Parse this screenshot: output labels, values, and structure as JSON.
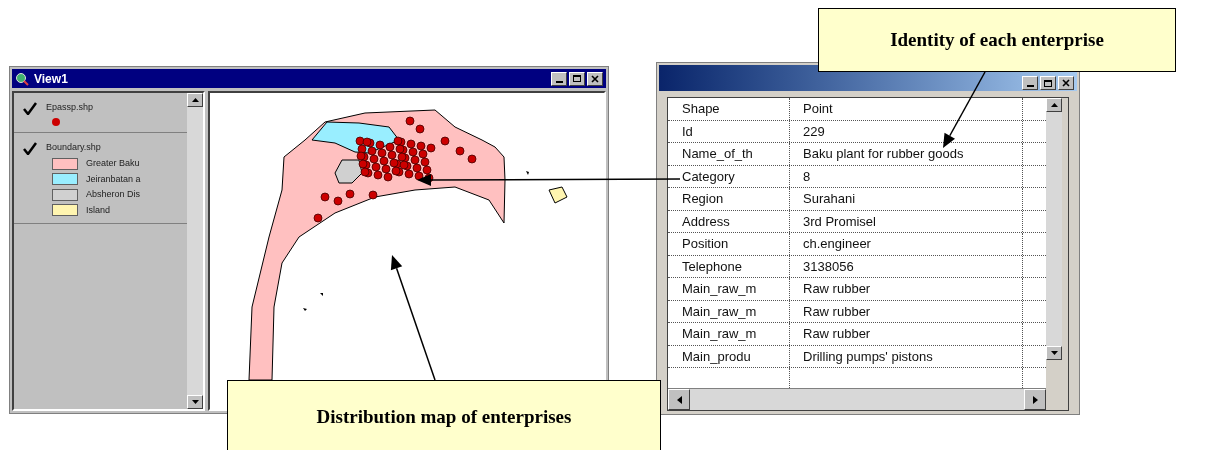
{
  "view_window": {
    "title": "View1",
    "legend": [
      {
        "name": "Epassp.shp",
        "visible": true,
        "symbols": [
          {
            "kind": "dot",
            "color": "#cc0000"
          }
        ]
      },
      {
        "name": "Boundary.shp",
        "visible": true,
        "symbols": [
          {
            "kind": "swatch",
            "label": "Greater Baku",
            "color": "#ffc0c0"
          },
          {
            "kind": "swatch",
            "label": "Jeiranbatan a",
            "color": "#99eeff"
          },
          {
            "kind": "swatch",
            "label": "Absheron Dis",
            "color": "#d0d0d0"
          },
          {
            "kind": "swatch",
            "label": "Island",
            "color": "#fff5b0"
          }
        ]
      }
    ]
  },
  "table_window": {
    "rows": [
      {
        "field": "Shape",
        "value": "Point"
      },
      {
        "field": "Id",
        "value": "229"
      },
      {
        "field": "Name_of_th",
        "value": "Baku plant for rubber goods"
      },
      {
        "field": "Category",
        "value": "8"
      },
      {
        "field": "Region",
        "value": "Surahani"
      },
      {
        "field": "Address",
        "value": "3rd Promisel"
      },
      {
        "field": "Position",
        "value": "ch.engineer"
      },
      {
        "field": "Telephone",
        "value": "3138056"
      },
      {
        "field": "Main_raw_m",
        "value": "Raw rubber"
      },
      {
        "field": "Main_raw_m",
        "value": "Raw rubber"
      },
      {
        "field": "Main_raw_m",
        "value": "Raw rubber"
      },
      {
        "field": "Main_produ",
        "value": "Drilling pumps' pistons"
      }
    ]
  },
  "callouts": [
    {
      "text": "Identity of each enterprise"
    },
    {
      "text": "Distribution map of enterprises"
    }
  ]
}
